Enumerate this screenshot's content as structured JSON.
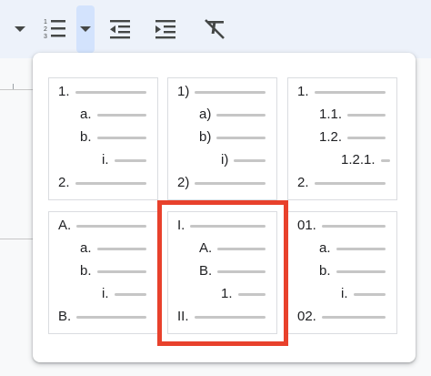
{
  "toolbar": {
    "buttons": [
      {
        "name": "dropdown-arrow-icon",
        "label": ""
      },
      {
        "name": "numbered-list-icon",
        "label": ""
      },
      {
        "name": "numbered-list-dropdown-icon",
        "label": ""
      },
      {
        "name": "decrease-indent-icon",
        "label": ""
      },
      {
        "name": "increase-indent-icon",
        "label": ""
      },
      {
        "name": "clear-formatting-icon",
        "label": ""
      }
    ]
  },
  "menu": {
    "presets": [
      {
        "items": [
          {
            "label": "1.",
            "level": 0
          },
          {
            "label": "a.",
            "level": 1
          },
          {
            "label": "b.",
            "level": 1
          },
          {
            "label": "i.",
            "level": 2
          },
          {
            "label": "2.",
            "level": 0
          }
        ]
      },
      {
        "items": [
          {
            "label": "1)",
            "level": 0
          },
          {
            "label": "a)",
            "level": 1
          },
          {
            "label": "b)",
            "level": 1
          },
          {
            "label": "i)",
            "level": 2
          },
          {
            "label": "2)",
            "level": 0
          }
        ]
      },
      {
        "items": [
          {
            "label": "1.",
            "level": 0
          },
          {
            "label": "1.1.",
            "level": 1
          },
          {
            "label": "1.2.",
            "level": 1
          },
          {
            "label": "1.2.1.",
            "level": 2
          },
          {
            "label": "2.",
            "level": 0
          }
        ]
      },
      {
        "items": [
          {
            "label": "A.",
            "level": 0
          },
          {
            "label": "a.",
            "level": 1
          },
          {
            "label": "b.",
            "level": 1
          },
          {
            "label": "i.",
            "level": 2
          },
          {
            "label": "B.",
            "level": 0
          }
        ]
      },
      {
        "items": [
          {
            "label": "I.",
            "level": 0
          },
          {
            "label": "A.",
            "level": 1
          },
          {
            "label": "B.",
            "level": 1
          },
          {
            "label": "1.",
            "level": 2
          },
          {
            "label": "II.",
            "level": 0
          }
        ],
        "highlighted": true
      },
      {
        "items": [
          {
            "label": "01.",
            "level": 0
          },
          {
            "label": "a.",
            "level": 1
          },
          {
            "label": "b.",
            "level": 1
          },
          {
            "label": "i.",
            "level": 2
          },
          {
            "label": "02.",
            "level": 0
          }
        ]
      }
    ]
  },
  "colors": {
    "highlight": "#e8412c",
    "toolbar_bg": "#edf2fa",
    "active_button_bg": "#d3e3fd",
    "placeholder_line": "#c6c6c6"
  }
}
